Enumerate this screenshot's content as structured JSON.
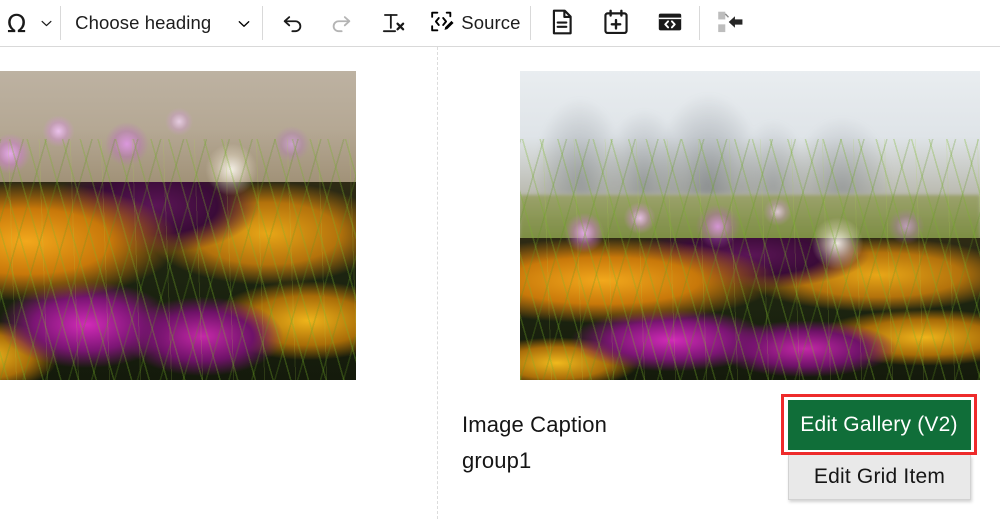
{
  "toolbar": {
    "special_character": {
      "label": "Ω",
      "icon": "omega-icon",
      "dropdown_icon": "chevron-down-icon"
    },
    "heading": {
      "label": "Choose heading",
      "dropdown_icon": "chevron-down-icon"
    },
    "undo": {
      "icon": "undo-icon",
      "enabled": true
    },
    "redo": {
      "icon": "redo-icon",
      "enabled": false
    },
    "remove_format": {
      "icon": "remove-format-icon"
    },
    "source": {
      "label": "Source",
      "icon": "source-code-edit-icon"
    },
    "insert_page": {
      "icon": "document-icon"
    },
    "insert_event": {
      "icon": "calendar-plus-icon"
    },
    "insert_code_block": {
      "icon": "code-block-icon"
    },
    "insert_sidebar": {
      "icon": "insert-left-arrow-icon",
      "enabled": false
    }
  },
  "content": {
    "left_image": {
      "alt": "Close-up of purple and yellow crocus flowers"
    },
    "right_image": {
      "alt": "Crocus meadow in front of a blurred park skyline"
    },
    "caption_line1": "Image Caption",
    "caption_line2": "group1"
  },
  "actions": {
    "edit_gallery": "Edit Gallery (V2)",
    "edit_grid_item": "Edit Grid Item"
  },
  "colors": {
    "primary_green": "#106e39",
    "highlight_red": "#ee2b2b",
    "secondary_gray": "#e9e9e9",
    "toolbar_border": "#d9d9d9"
  }
}
